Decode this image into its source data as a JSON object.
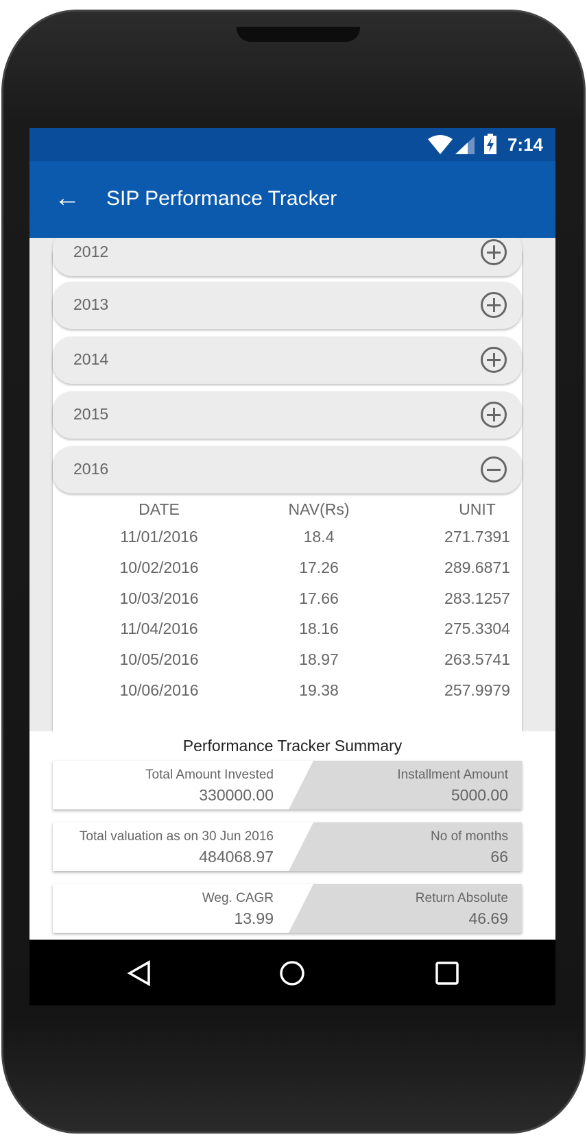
{
  "status_bar": {
    "time": "7:14",
    "icons": [
      "wifi-icon",
      "signal-icon",
      "battery-charging-icon"
    ]
  },
  "toolbar": {
    "title": "SIP Performance Tracker",
    "back_icon": "arrow-left-icon"
  },
  "years": [
    {
      "label": "2012",
      "expanded": false
    },
    {
      "label": "2013",
      "expanded": false
    },
    {
      "label": "2014",
      "expanded": false
    },
    {
      "label": "2015",
      "expanded": false
    },
    {
      "label": "2016",
      "expanded": true
    }
  ],
  "table": {
    "headers": [
      "DATE",
      "NAV(Rs)",
      "UNIT"
    ],
    "rows": [
      [
        "11/01/2016",
        "18.4",
        "271.7391"
      ],
      [
        "10/02/2016",
        "17.26",
        "289.6871"
      ],
      [
        "10/03/2016",
        "17.66",
        "283.1257"
      ],
      [
        "11/04/2016",
        "18.16",
        "275.3304"
      ],
      [
        "10/05/2016",
        "18.97",
        "263.5741"
      ],
      [
        "10/06/2016",
        "19.38",
        "257.9979"
      ]
    ]
  },
  "summary": {
    "title": "Performance Tracker Summary",
    "cards": [
      {
        "left_label": "Total Amount Invested",
        "left_value": "330000.00",
        "right_label": "Installment Amount",
        "right_value": "5000.00"
      },
      {
        "left_label": "Total valuation as on 30 Jun 2016",
        "left_value": "484068.97",
        "right_label": "No of months",
        "right_value": "66"
      },
      {
        "left_label": "Weg. CAGR",
        "left_value": "13.99",
        "right_label": "Return Absolute",
        "right_value": "46.69"
      }
    ]
  },
  "colors": {
    "status_bar": "#0a4d9b",
    "toolbar": "#0b5aae"
  }
}
